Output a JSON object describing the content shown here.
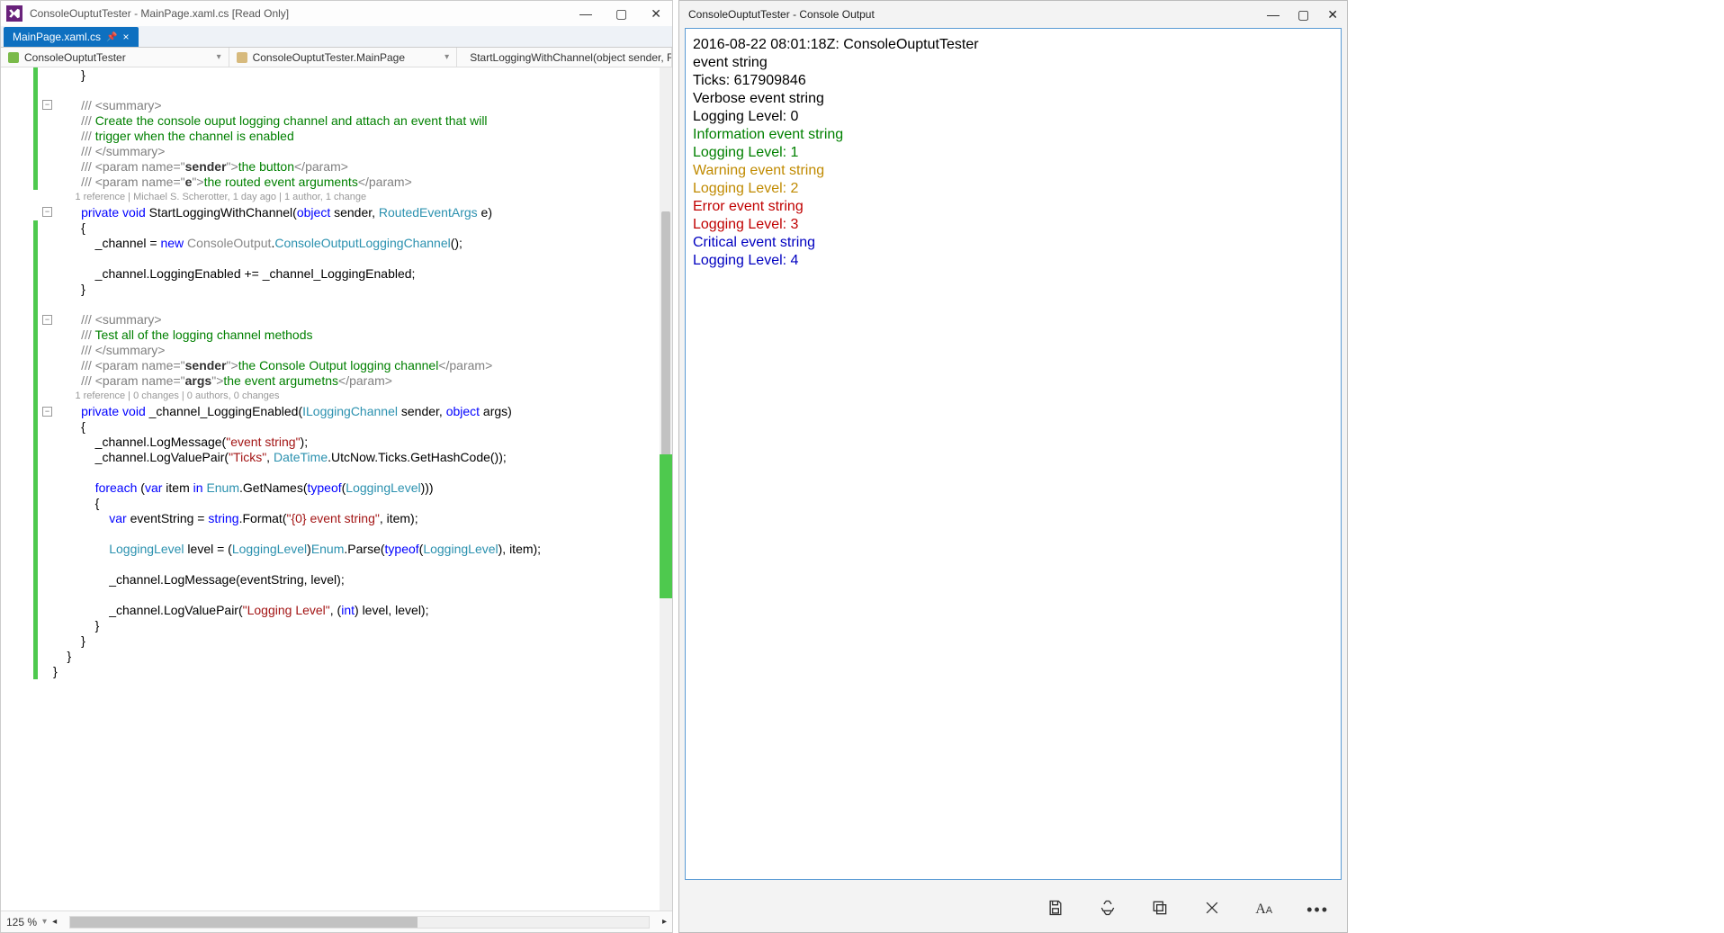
{
  "vs": {
    "title": "ConsoleOuptutTester - MainPage.xaml.cs [Read Only]",
    "tab": {
      "label": "MainPage.xaml.cs",
      "pinned": true
    },
    "nav": {
      "project": "ConsoleOuptutTester",
      "type": "ConsoleOuptutTester.MainPage",
      "member": "StartLoggingWithChannel(object sender, RoutedEve"
    },
    "codelens1": "1 reference | Michael S. Scherotter, 1 day ago | 1 author, 1 change",
    "codelens2": "1 reference | 0 changes | 0 authors, 0 changes",
    "zoom": "125 %"
  },
  "console": {
    "title": "ConsoleOuptutTester - Console Output",
    "lines": [
      {
        "cls": "c-black",
        "t": "2016-08-22 08:01:18Z: ConsoleOuptutTester"
      },
      {
        "cls": "c-black",
        "t": "event string"
      },
      {
        "cls": "c-black",
        "t": "Ticks: 617909846"
      },
      {
        "cls": "c-black",
        "t": "Verbose event string"
      },
      {
        "cls": "c-black",
        "t": "Logging Level: 0"
      },
      {
        "cls": "c-green",
        "t": "Information event string"
      },
      {
        "cls": "c-green",
        "t": "Logging Level: 1"
      },
      {
        "cls": "c-yellow",
        "t": "Warning event string"
      },
      {
        "cls": "c-yellow",
        "t": "Logging Level: 2"
      },
      {
        "cls": "c-red",
        "t": "Error event string"
      },
      {
        "cls": "c-red",
        "t": "Logging Level: 3"
      },
      {
        "cls": "c-blue",
        "t": "Critical event string"
      },
      {
        "cls": "c-blue",
        "t": "Logging Level: 4"
      }
    ]
  },
  "code": [
    {
      "i": 3,
      "h": "        }"
    },
    {
      "i": 0,
      "h": ""
    },
    {
      "i": 3,
      "h": "        <span class='c-doc'>///</span> <span class='c-docparam'>&lt;summary&gt;</span>"
    },
    {
      "i": 3,
      "h": "        <span class='c-doc'>///</span> <span class='c-comment'>Create the console ouput logging channel and attach an event that will</span>"
    },
    {
      "i": 3,
      "h": "        <span class='c-doc'>///</span> <span class='c-comment'>trigger when the channel is enabled</span>"
    },
    {
      "i": 3,
      "h": "        <span class='c-doc'>///</span> <span class='c-docparam'>&lt;/summary&gt;</span>"
    },
    {
      "i": 3,
      "h": "        <span class='c-doc'>///</span> <span class='c-docparam'>&lt;param name=</span><span class='c-doc'>\"</span><span style='color:#333;font-weight:bold'>sender</span><span class='c-doc'>\"</span><span class='c-docparam'>&gt;</span><span class='c-comment'>the button</span><span class='c-docparam'>&lt;/param&gt;</span>"
    },
    {
      "i": 3,
      "h": "        <span class='c-doc'>///</span> <span class='c-docparam'>&lt;param name=</span><span class='c-doc'>\"</span><span style='color:#333;font-weight:bold'>e</span><span class='c-doc'>\"</span><span class='c-docparam'>&gt;</span><span class='c-comment'>the routed event arguments</span><span class='c-docparam'>&lt;/param&gt;</span>"
    },
    {
      "lens": 1
    },
    {
      "i": 3,
      "h": "        <span class='c-key'>private</span> <span class='c-key'>void</span> StartLoggingWithChannel(<span class='c-key'>object</span> sender, <span class='c-type'>RoutedEventArgs</span> e)"
    },
    {
      "i": 3,
      "h": "        {"
    },
    {
      "i": 3,
      "h": "            _channel = <span class='c-key'>new</span> <span style='color:#888'>ConsoleOutput</span>.<span class='c-type'>ConsoleOutputLoggingChannel</span>();"
    },
    {
      "i": 0,
      "h": ""
    },
    {
      "i": 3,
      "h": "            _channel.LoggingEnabled += _channel_LoggingEnabled;"
    },
    {
      "i": 3,
      "h": "        }"
    },
    {
      "i": 0,
      "h": ""
    },
    {
      "i": 3,
      "h": "        <span class='c-doc'>///</span> <span class='c-docparam'>&lt;summary&gt;</span>"
    },
    {
      "i": 3,
      "h": "        <span class='c-doc'>///</span> <span class='c-comment'>Test all of the logging channel methods</span>"
    },
    {
      "i": 3,
      "h": "        <span class='c-doc'>///</span> <span class='c-docparam'>&lt;/summary&gt;</span>"
    },
    {
      "i": 3,
      "h": "        <span class='c-doc'>///</span> <span class='c-docparam'>&lt;param name=</span><span class='c-doc'>\"</span><span style='color:#333;font-weight:bold'>sender</span><span class='c-doc'>\"</span><span class='c-docparam'>&gt;</span><span class='c-comment'>the Console Output logging channel</span><span class='c-docparam'>&lt;/param&gt;</span>"
    },
    {
      "i": 3,
      "h": "        <span class='c-doc'>///</span> <span class='c-docparam'>&lt;param name=</span><span class='c-doc'>\"</span><span style='color:#333;font-weight:bold'>args</span><span class='c-doc'>\"</span><span class='c-docparam'>&gt;</span><span class='c-comment'>the event argumetns</span><span class='c-docparam'>&lt;/param&gt;</span>"
    },
    {
      "lens": 2
    },
    {
      "i": 3,
      "h": "        <span class='c-key'>private</span> <span class='c-key'>void</span> _channel_LoggingEnabled(<span class='c-type'>ILoggingChannel</span> sender, <span class='c-key'>object</span> args)"
    },
    {
      "i": 3,
      "h": "        {"
    },
    {
      "i": 3,
      "h": "            _channel.LogMessage(<span class='c-str'>\"event string\"</span>);"
    },
    {
      "i": 3,
      "h": "            _channel.LogValuePair(<span class='c-str'>\"Ticks\"</span>, <span class='c-type'>DateTime</span>.UtcNow.Ticks.GetHashCode());"
    },
    {
      "i": 0,
      "h": ""
    },
    {
      "i": 3,
      "h": "            <span class='c-key'>foreach</span> (<span class='c-key'>var</span> item <span class='c-key'>in</span> <span class='c-type'>Enum</span>.GetNames(<span class='c-key'>typeof</span>(<span class='c-type'>LoggingLevel</span>)))"
    },
    {
      "i": 3,
      "h": "            {"
    },
    {
      "i": 3,
      "h": "                <span class='c-key'>var</span> eventString = <span class='c-key'>string</span>.Format(<span class='c-str'>\"{0} event string\"</span>, item);"
    },
    {
      "i": 0,
      "h": ""
    },
    {
      "i": 3,
      "h": "                <span class='c-type'>LoggingLevel</span> level = (<span class='c-type'>LoggingLevel</span>)<span class='c-type'>Enum</span>.Parse(<span class='c-key'>typeof</span>(<span class='c-type'>LoggingLevel</span>), item);"
    },
    {
      "i": 0,
      "h": ""
    },
    {
      "i": 3,
      "h": "                _channel.LogMessage(eventString, level);"
    },
    {
      "i": 0,
      "h": ""
    },
    {
      "i": 3,
      "h": "                _channel.LogValuePair(<span class='c-str'>\"Logging Level\"</span>, (<span class='c-key'>int</span>) level, level);"
    },
    {
      "i": 3,
      "h": "            }"
    },
    {
      "i": 3,
      "h": "        }"
    },
    {
      "i": 3,
      "h": "    }"
    },
    {
      "i": 3,
      "h": "}"
    }
  ]
}
